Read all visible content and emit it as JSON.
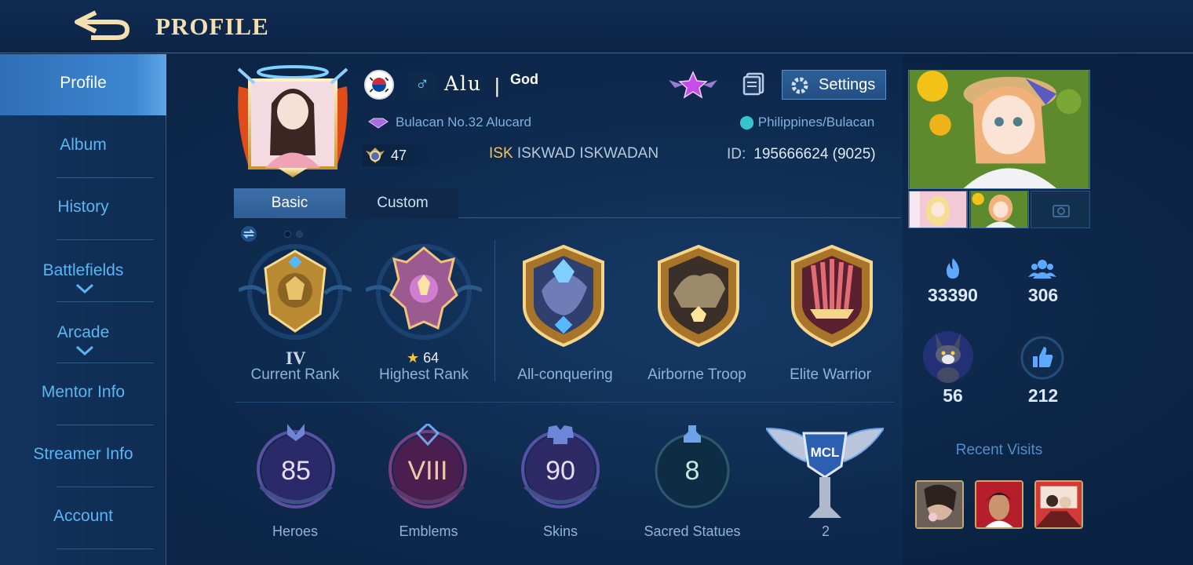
{
  "header": {
    "title": "PROFILE"
  },
  "sidebar": {
    "items": [
      {
        "label": "Profile"
      },
      {
        "label": "Album"
      },
      {
        "label": "History"
      },
      {
        "label": "Battlefields"
      },
      {
        "label": "Arcade"
      },
      {
        "label": "Mentor Info"
      },
      {
        "label": "Streamer Info"
      },
      {
        "label": "Account"
      }
    ]
  },
  "profile": {
    "name": "Alu",
    "separator": "|",
    "tag": "God",
    "title": "Bulacan No.32 Alucard",
    "level": "47",
    "squad_abbr": "ISK",
    "squad_name": "ISKWAD ISKWADAN",
    "location": "Philippines/Bulacan",
    "id_label": "ID:",
    "id_value": "195666624 (9025)",
    "settings_label": "Settings"
  },
  "tabs": [
    {
      "label": "Basic"
    },
    {
      "label": "Custom"
    }
  ],
  "medals": [
    {
      "label": "Current Rank",
      "value": "IV"
    },
    {
      "label": "Highest Rank",
      "value": "64"
    },
    {
      "label": "All-conquering"
    },
    {
      "label": "Airborne Troop"
    },
    {
      "label": "Elite Warrior"
    }
  ],
  "stats": [
    {
      "label": "Heroes",
      "value": "85"
    },
    {
      "label": "Emblems",
      "value": "VIII"
    },
    {
      "label": "Skins",
      "value": "90"
    },
    {
      "label": "Sacred Statues",
      "value": "8"
    },
    {
      "label": "2"
    }
  ],
  "right": {
    "popularity": "33390",
    "friends": "306",
    "pet": "56",
    "likes": "212",
    "recent_visits": "Recent Visits"
  }
}
